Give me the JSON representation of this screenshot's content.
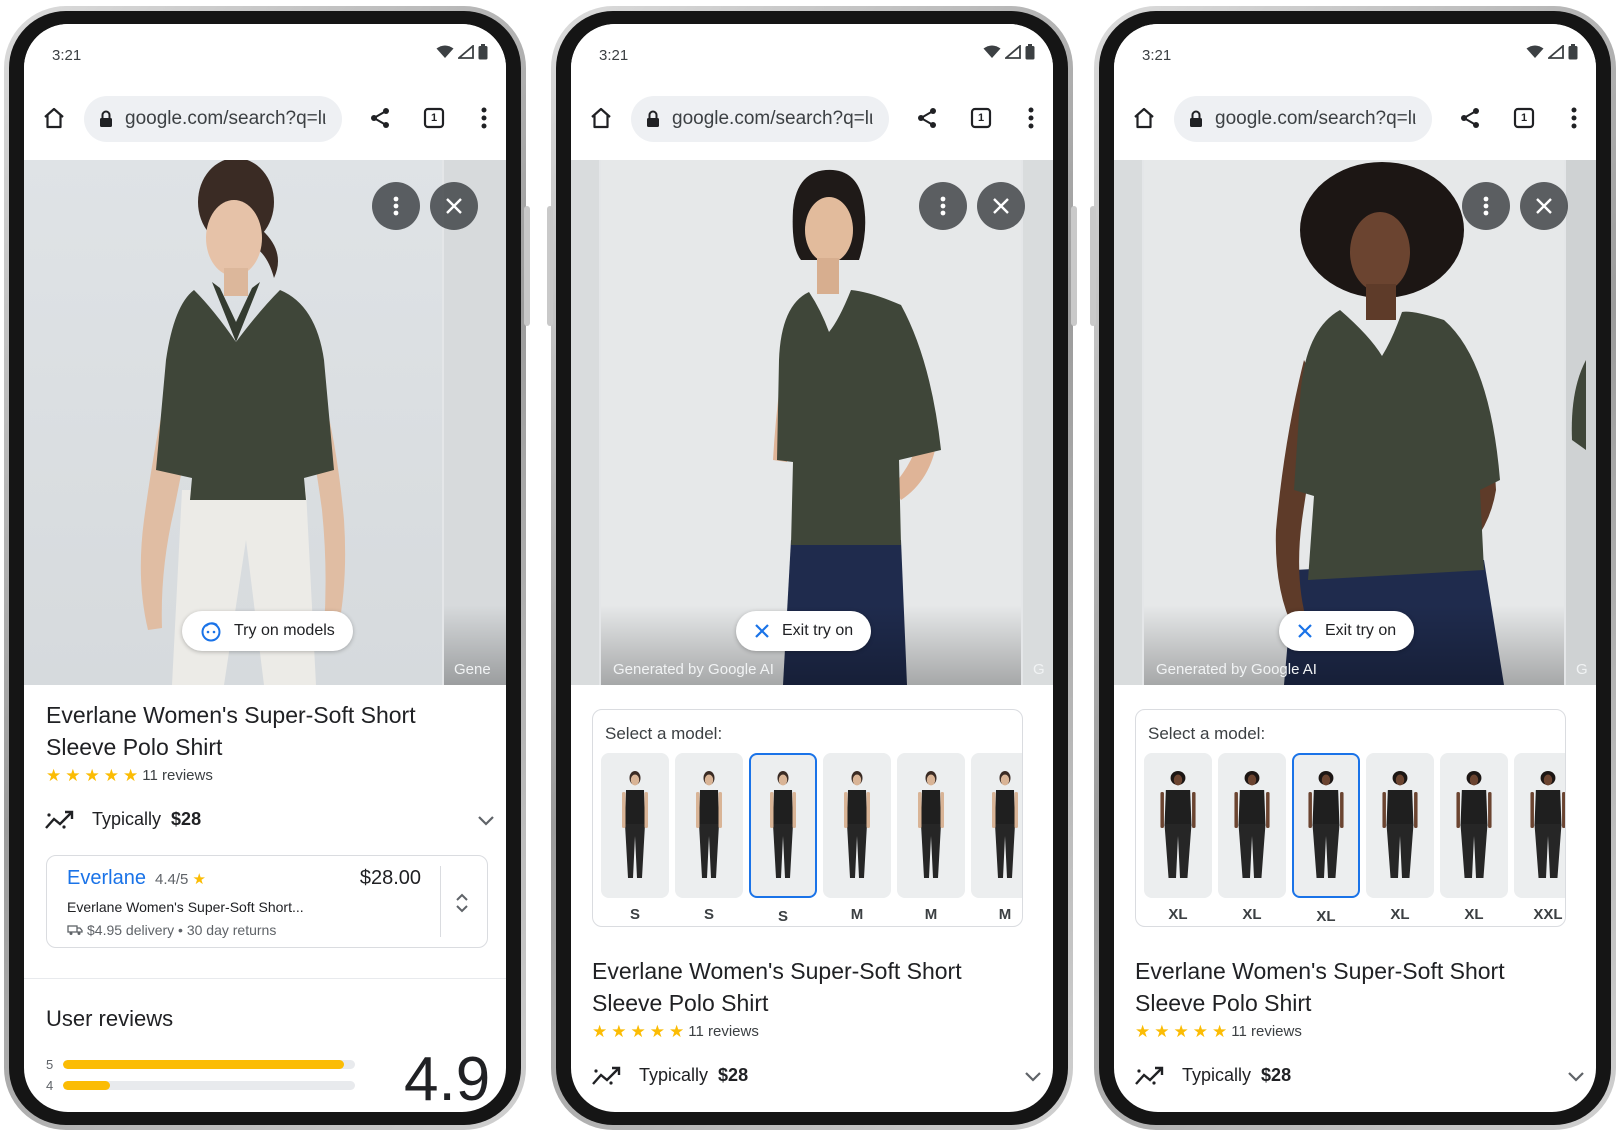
{
  "colors": {
    "accent": "#1a73e8",
    "star": "#fbbc04",
    "shirt": "#3f4639",
    "overlay_button": "#3c4043"
  },
  "phones": [
    {
      "status": {
        "time": "3:21"
      },
      "browser": {
        "url": "google.com/search?q=lι",
        "tab_count": "1"
      },
      "image": {
        "try_on_label": "Try on models",
        "next_caption": "Gene"
      },
      "product": {
        "title_line1": "Everlane Women's Super-Soft Short",
        "title_line2": "Sleeve Polo Shirt",
        "reviews": "11 reviews",
        "rating_stars": 5,
        "typically_label": "Typically",
        "typically_price": "$28"
      },
      "seller": {
        "name": "Everlane",
        "rating": "4.4/5",
        "price": "$28.00",
        "title": "Everlane Women's Super-Soft Short...",
        "meta": "$4.95 delivery • 30 day returns"
      },
      "user_reviews": {
        "heading": "User reviews",
        "bars": [
          {
            "label": "5",
            "fraction": 0.96
          },
          {
            "label": "4",
            "fraction": 0.16
          }
        ],
        "average": "4.9"
      }
    },
    {
      "status": {
        "time": "3:21"
      },
      "browser": {
        "url": "google.com/search?q=lι",
        "tab_count": "1"
      },
      "image": {
        "exit_label": "Exit try on",
        "caption": "Generated by Google AI",
        "next_caption": "G"
      },
      "select": {
        "label": "Select a model:",
        "selected_index": 2,
        "sizes": [
          "S",
          "S",
          "S",
          "M",
          "M",
          "M"
        ]
      },
      "product": {
        "title_line1": "Everlane Women's Super-Soft Short",
        "title_line2": "Sleeve Polo Shirt",
        "reviews": "11 reviews",
        "rating_stars": 5,
        "typically_label": "Typically",
        "typically_price": "$28"
      }
    },
    {
      "status": {
        "time": "3:21"
      },
      "browser": {
        "url": "google.com/search?q=lι",
        "tab_count": "1"
      },
      "image": {
        "exit_label": "Exit try on",
        "caption": "Generated by Google AI",
        "next_caption": "G"
      },
      "select": {
        "label": "Select a model:",
        "selected_index": 2,
        "sizes": [
          "XL",
          "XL",
          "XL",
          "XL",
          "XL",
          "XXL"
        ]
      },
      "product": {
        "title_line1": "Everlane Women's Super-Soft Short",
        "title_line2": "Sleeve Polo Shirt",
        "reviews": "11 reviews",
        "rating_stars": 5,
        "typically_label": "Typically",
        "typically_price": "$28"
      }
    }
  ]
}
